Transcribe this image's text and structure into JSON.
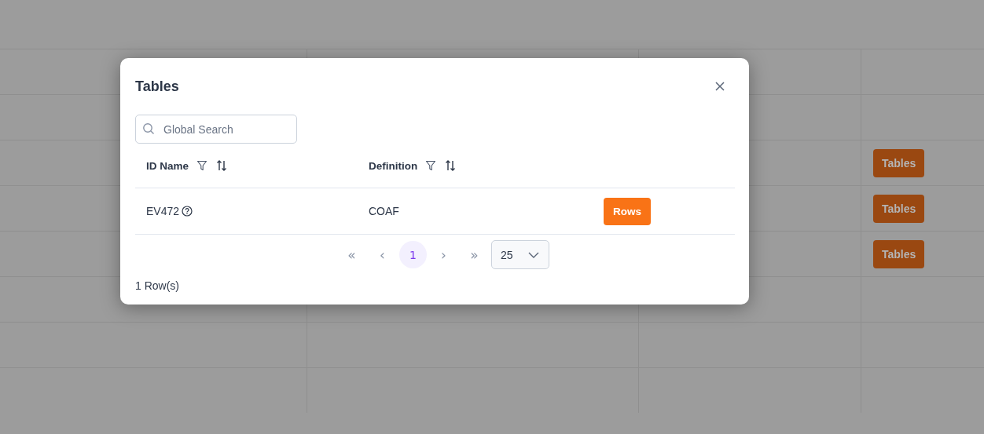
{
  "background_table": {
    "rows": [
      {
        "kind": "empty"
      },
      {
        "kind": "empty"
      },
      {
        "kind": "action",
        "button": "Tables"
      },
      {
        "kind": "action",
        "button": "Tables"
      },
      {
        "kind": "action",
        "button": "Tables"
      },
      {
        "kind": "empty"
      },
      {
        "kind": "empty"
      },
      {
        "kind": "empty"
      }
    ]
  },
  "dialog": {
    "title": "Tables",
    "search": {
      "placeholder": "Global Search"
    },
    "columns": [
      {
        "label": "ID Name"
      },
      {
        "label": "Definition"
      }
    ],
    "rows": [
      {
        "id_name": "EV472",
        "definition": "COAF",
        "button": "Rows"
      }
    ],
    "pagination": {
      "first": "«",
      "prev": "‹",
      "pages": [
        {
          "label": "1",
          "selected": true
        }
      ],
      "next": "›",
      "last": "»",
      "page_size": "25"
    },
    "row_count": "1 Row(s)"
  }
}
